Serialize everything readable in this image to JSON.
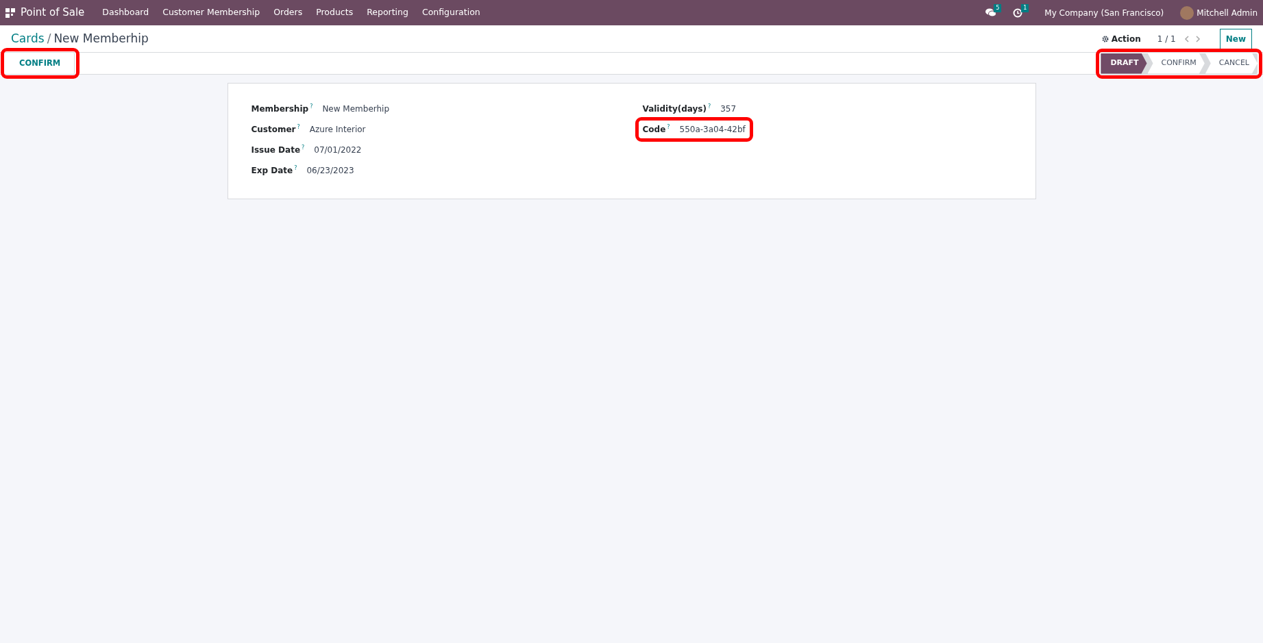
{
  "navbar": {
    "app_name": "Point of Sale",
    "menu": [
      {
        "label": "Dashboard"
      },
      {
        "label": "Customer Membership"
      },
      {
        "label": "Orders"
      },
      {
        "label": "Products"
      },
      {
        "label": "Reporting"
      },
      {
        "label": "Configuration"
      }
    ],
    "messages_count": "5",
    "activities_count": "1",
    "company": "My Company (San Francisco)",
    "user": "Mitchell Admin"
  },
  "breadcrumb": {
    "parent": "Cards",
    "separator": "/",
    "current": "New Memberhip"
  },
  "action_label": "Action",
  "pager": "1 / 1",
  "new_button": "New",
  "header_buttons": [
    {
      "label": "CONFIRM",
      "highlighted": true
    }
  ],
  "statusbar": {
    "highlighted": true,
    "stages": [
      {
        "label": "DRAFT",
        "selected": true
      },
      {
        "label": "CONFIRM",
        "selected": false
      },
      {
        "label": "CANCEL",
        "selected": false
      }
    ]
  },
  "form": {
    "left": [
      {
        "label": "Membership",
        "help": "?",
        "value": "New Memberhip",
        "highlighted": false
      },
      {
        "label": "Customer",
        "help": "?",
        "value": "Azure Interior",
        "highlighted": false
      },
      {
        "label": "Issue Date",
        "help": "?",
        "value": "07/01/2022",
        "highlighted": false
      },
      {
        "label": "Exp Date",
        "help": "?",
        "value": "06/23/2023",
        "highlighted": false
      }
    ],
    "right": [
      {
        "label": "Validity(days)",
        "help": "?",
        "value": "357",
        "highlighted": false
      },
      {
        "label": "Code",
        "help": "?",
        "value": "550a-3a04-42bf",
        "highlighted": true
      }
    ]
  }
}
